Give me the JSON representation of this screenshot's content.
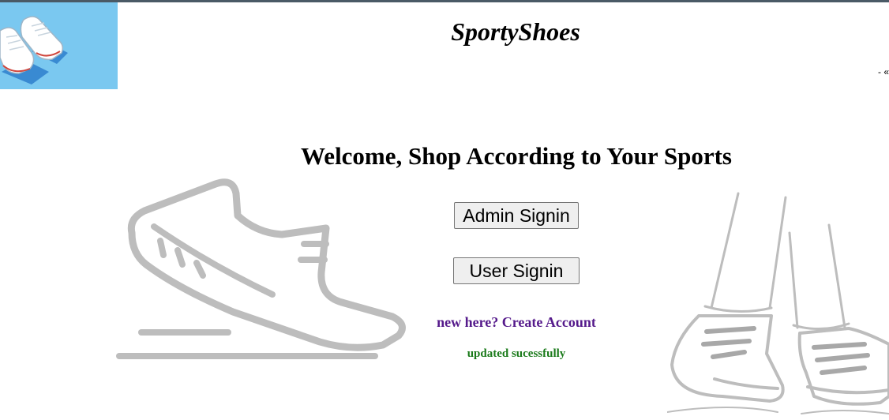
{
  "header": {
    "brand": "SportyShoes",
    "edge_mark": "- «"
  },
  "main": {
    "welcome": "Welcome, Shop According to Your Sports",
    "admin_signin_label": "Admin Signin",
    "user_signin_label": "User Signin",
    "create_account_label": "new here? Create Account",
    "status_message": "updated sucessfully"
  },
  "colors": {
    "top_bar": "#4a5a66",
    "logo_bg": "#7ac8f0",
    "link": "#551a8b",
    "status": "#1a7a1a",
    "illustration": "#bdbdbd"
  },
  "icons": {
    "logo": "sneakers-logo-icon",
    "left_art": "running-shoe-icon",
    "right_art": "walking-legs-icon"
  }
}
